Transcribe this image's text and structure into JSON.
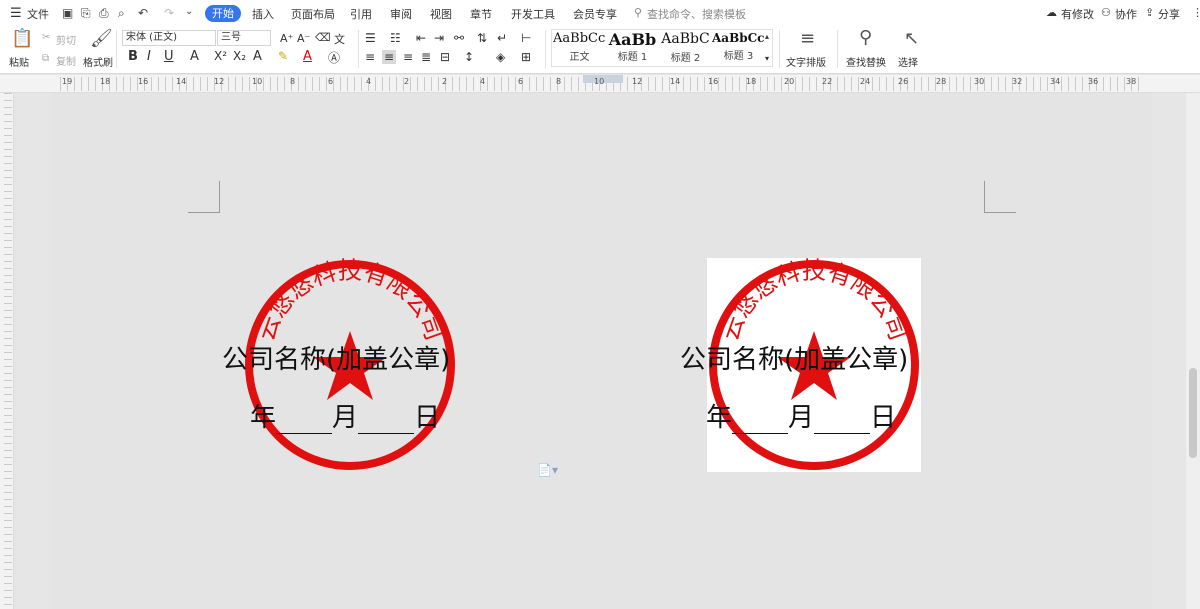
{
  "menubar": {
    "file_label": "文件",
    "tabs": [
      "开始",
      "插入",
      "页面布局",
      "引用",
      "审阅",
      "视图",
      "章节",
      "开发工具",
      "会员专享"
    ],
    "search_placeholder": "查找命令、搜索模板",
    "right": {
      "edit_status": "有修改",
      "collab": "协作",
      "share": "分享"
    }
  },
  "ribbon": {
    "paste": "粘贴",
    "cut": "剪切",
    "copy": "复制",
    "format_painter": "格式刷",
    "font_name": "宋体 (正文)",
    "font_size": "三号",
    "styles": [
      {
        "preview": "AaBbCcDd",
        "name": "正文"
      },
      {
        "preview": "AaBb",
        "name": "标题 1"
      },
      {
        "preview": "AaBbC",
        "name": "标题 2"
      },
      {
        "preview": "AaBbCcI",
        "name": "标题 3"
      }
    ],
    "text_layout": "文字排版",
    "find_replace": "查找替换",
    "select": "选择"
  },
  "ruler": {
    "labels": [
      "19",
      "18",
      "16",
      "14",
      "12",
      "10",
      "8",
      "6",
      "4",
      "2",
      "2",
      "4",
      "6",
      "8",
      "10",
      "12",
      "14",
      "16",
      "18",
      "20",
      "22",
      "24",
      "26",
      "28",
      "30",
      "32",
      "34",
      "36",
      "38"
    ]
  },
  "document": {
    "stamp_left": {
      "company_line": "公司名称(加盖公章)",
      "date_year": "年",
      "date_month": "月",
      "date_day": "日",
      "seal_text": "云悠悠科技有限公司"
    },
    "stamp_right": {
      "company_line": "公司名称(加盖公章)",
      "date_year": "年",
      "date_month": "月",
      "date_day": "日",
      "seal_text": "云悠悠科技有限公司"
    }
  },
  "colors": {
    "accent": "#3575f0",
    "seal_red": "#e01010"
  }
}
